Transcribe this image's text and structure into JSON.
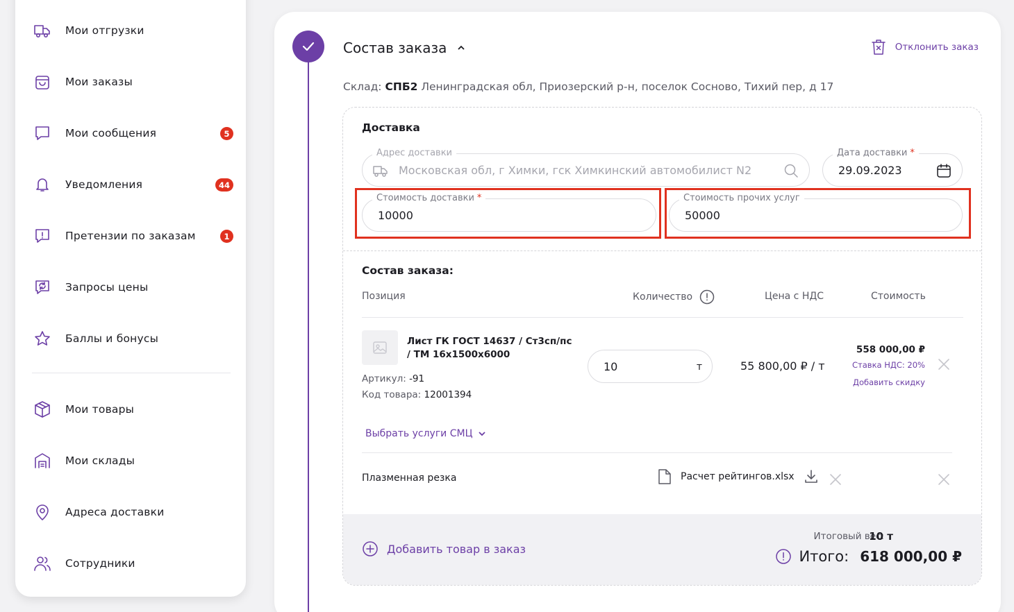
{
  "sidebar": {
    "items": [
      {
        "label": "Мои отгрузки",
        "icon": "truck-icon"
      },
      {
        "label": "Мои заказы",
        "icon": "bag-icon"
      },
      {
        "label": "Мои сообщения",
        "icon": "chat-icon",
        "badge": "5"
      },
      {
        "label": "Уведомления",
        "icon": "bell-icon",
        "badge": "44"
      },
      {
        "label": "Претензии по заказам",
        "icon": "alert-chat-icon",
        "badge": "1"
      },
      {
        "label": "Запросы цены",
        "icon": "refresh-chat-icon"
      },
      {
        "label": "Баллы и бонусы",
        "icon": "star-icon"
      },
      {
        "label": "Мои товары",
        "icon": "box-icon"
      },
      {
        "label": "Мои склады",
        "icon": "warehouse-icon"
      },
      {
        "label": "Адреса доставки",
        "icon": "location-icon"
      },
      {
        "label": "Сотрудники",
        "icon": "users-icon"
      }
    ]
  },
  "order": {
    "section_title": "Состав заказа",
    "reject_label": "Отклонить заказ",
    "warehouse_label": "Склад:",
    "warehouse_code": "СПБ2",
    "warehouse_address": "Ленинградская обл, Приозерский р-н, поселок Сосново, Тихий пер, д 17"
  },
  "delivery": {
    "title": "Доставка",
    "address_label": "Адрес доставки",
    "address_value": "Московская обл, г Химки, гск Химкинский автомобилист N2",
    "date_label": "Дата доставки",
    "date_value": "29.09.2023",
    "cost_label": "Стоимость доставки",
    "cost_value": "10000",
    "other_label": "Стоимость прочих услуг",
    "other_value": "50000",
    "required_mark": "*"
  },
  "composition": {
    "title": "Состав заказа:",
    "headers": {
      "position": "Позиция",
      "quantity": "Количество",
      "price": "Цена с НДС",
      "cost": "Стоимость"
    },
    "item": {
      "name": "Лист ГК ГОСТ 14637 / Ст3сп/пс / ТМ 16х1500х6000",
      "article_label": "Артикул:",
      "article_value": "-91",
      "code_label": "Код товара:",
      "code_value": "12001394",
      "quantity": "10",
      "unit": "т",
      "price": "55 800,00 ₽ / т",
      "cost": "558 000,00 ₽",
      "vat": "Ставка НДС: 20%",
      "discount_link": "Добавить скидку"
    },
    "smc_link": "Выбрать услуги СМЦ",
    "service": {
      "name": "Плазменная резка",
      "file_name": "Расчет рейтингов.xlsx"
    }
  },
  "footer": {
    "add_item": "Добавить товар в заказ",
    "weight_label": "Итоговый вес:",
    "weight_value": "10 т",
    "total_label": "Итого:",
    "total_value": "618 000,00 ₽"
  },
  "colors": {
    "accent": "#6c3fa6",
    "badge": "#e0311f",
    "highlight": "#e0311f"
  }
}
